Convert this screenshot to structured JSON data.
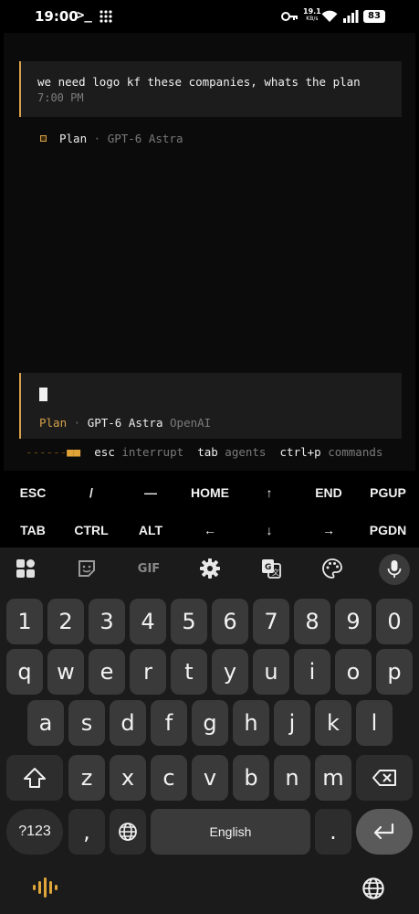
{
  "status_bar": {
    "time": "19:00",
    "terminal_glyph": ">_",
    "net_speed_value": "19.1",
    "net_speed_unit": "KB/s",
    "battery": "83"
  },
  "terminal": {
    "user_message": "we need logo kf these companies, whats the plan",
    "message_time": "7:00 PM",
    "agent_label": "Plan",
    "agent_separator": "·",
    "agent_model": "GPT-6 Astra",
    "input_mode": "Plan",
    "input_separator": "·",
    "input_model": "GPT-6 Astra",
    "input_provider": "OpenAI",
    "hint_dashes": "------",
    "hint_blocks": "■■",
    "hints": [
      {
        "key": "esc",
        "desc": "interrupt"
      },
      {
        "key": "tab",
        "desc": "agents"
      },
      {
        "key": "ctrl+p",
        "desc": "commands"
      }
    ]
  },
  "extra_keys": {
    "row1": [
      "ESC",
      "/",
      "—",
      "HOME",
      "↑",
      "END",
      "PGUP"
    ],
    "row2": [
      "TAB",
      "CTRL",
      "ALT",
      "←",
      "↓",
      "→",
      "PGDN"
    ]
  },
  "keyboard": {
    "toolbar_icons": [
      "apps-icon",
      "sticker-icon",
      "gif-icon",
      "settings-icon",
      "translate-icon",
      "palette-icon",
      "mic-icon"
    ],
    "gif_label": "GIF",
    "numbers": [
      "1",
      "2",
      "3",
      "4",
      "5",
      "6",
      "7",
      "8",
      "9",
      "0"
    ],
    "row1": [
      "q",
      "w",
      "e",
      "r",
      "t",
      "y",
      "u",
      "i",
      "o",
      "p"
    ],
    "row2": [
      "a",
      "s",
      "d",
      "f",
      "g",
      "h",
      "j",
      "k",
      "l"
    ],
    "row3": [
      "z",
      "x",
      "c",
      "v",
      "b",
      "n",
      "m"
    ],
    "symbols_label": "?123",
    "comma": ",",
    "space_label": "English",
    "period": "."
  },
  "colors": {
    "accent": "#d7a24b",
    "terminal_bg": "#0b0b0b",
    "block_bg": "#1c1c1c",
    "key_bg": "#3a3a3a",
    "keyboard_bg": "#1b1b1b"
  }
}
